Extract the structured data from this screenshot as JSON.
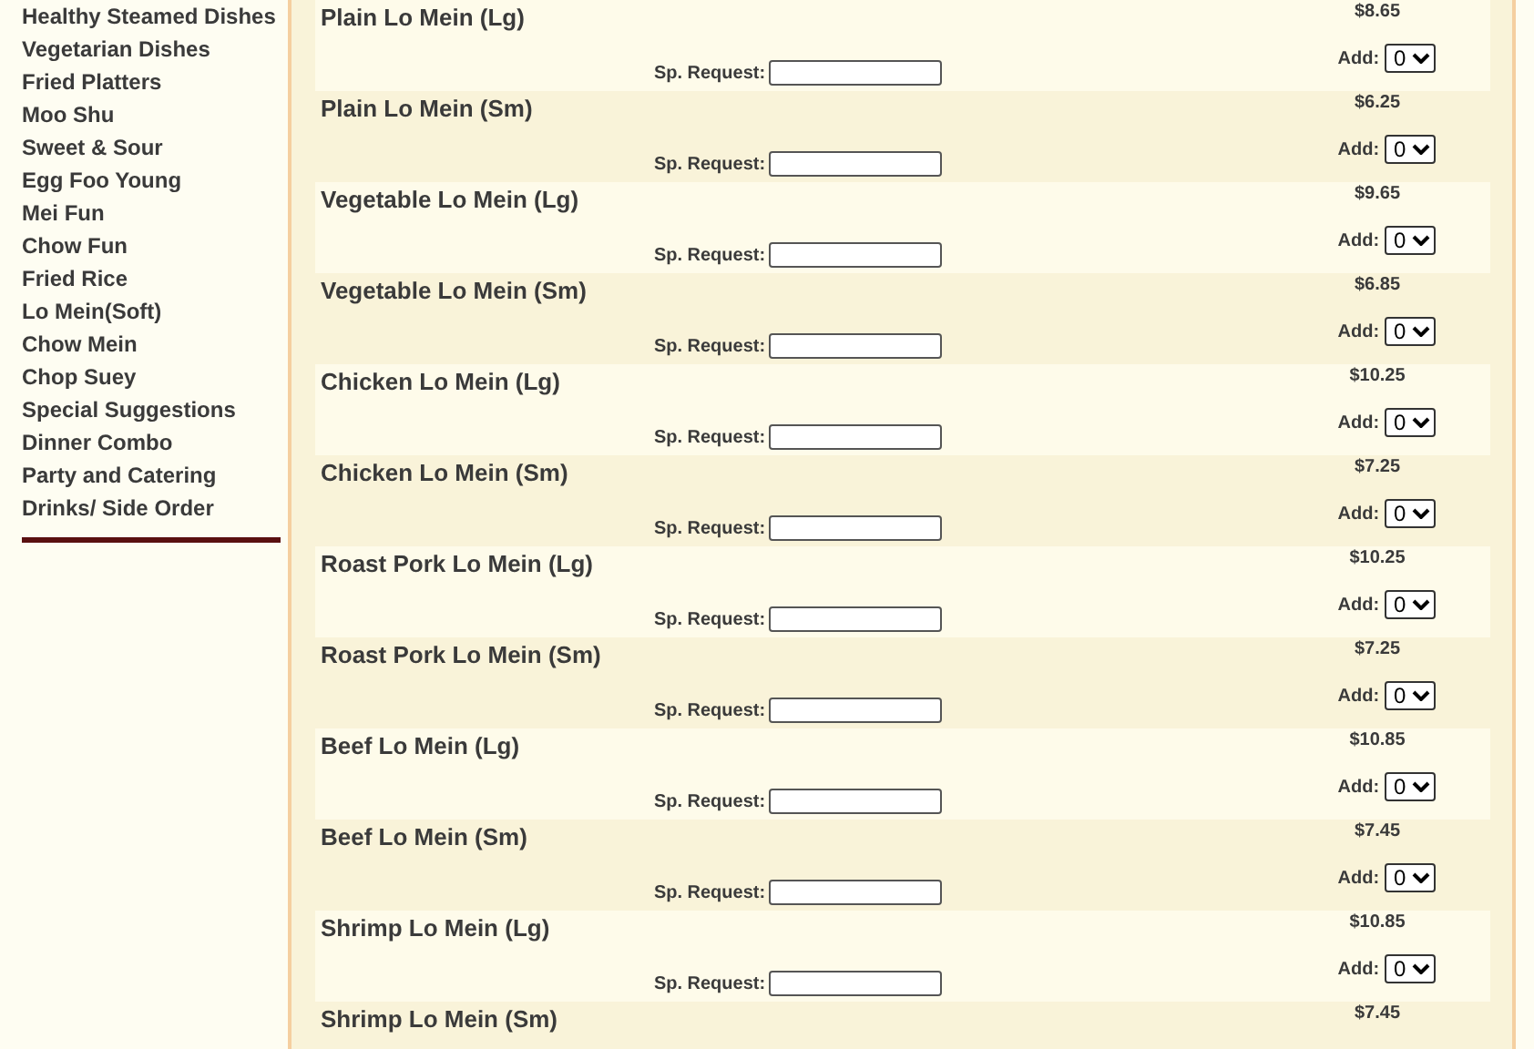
{
  "sidebar": {
    "items": [
      {
        "label": "Healthy Steamed Dishes"
      },
      {
        "label": "Vegetarian Dishes"
      },
      {
        "label": "Fried Platters"
      },
      {
        "label": "Moo Shu"
      },
      {
        "label": "Sweet & Sour"
      },
      {
        "label": "Egg Foo Young"
      },
      {
        "label": "Mei Fun"
      },
      {
        "label": "Chow Fun"
      },
      {
        "label": "Fried Rice"
      },
      {
        "label": "Lo Mein(Soft)"
      },
      {
        "label": "Chow Mein"
      },
      {
        "label": "Chop Suey"
      },
      {
        "label": "Special Suggestions"
      },
      {
        "label": "Dinner Combo"
      },
      {
        "label": "Party and Catering"
      },
      {
        "label": "Drinks/ Side Order"
      }
    ]
  },
  "menu_items": [
    {
      "name": "Plain Lo Mein (Lg)",
      "price": "$8.65",
      "request_label": "Sp. Request:",
      "add_label": "Add:",
      "quantity": "0"
    },
    {
      "name": "Plain Lo Mein (Sm)",
      "price": "$6.25",
      "request_label": "Sp. Request:",
      "add_label": "Add:",
      "quantity": "0"
    },
    {
      "name": "Vegetable Lo Mein (Lg)",
      "price": "$9.65",
      "request_label": "Sp. Request:",
      "add_label": "Add:",
      "quantity": "0"
    },
    {
      "name": "Vegetable Lo Mein (Sm)",
      "price": "$6.85",
      "request_label": "Sp. Request:",
      "add_label": "Add:",
      "quantity": "0"
    },
    {
      "name": "Chicken Lo Mein (Lg)",
      "price": "$10.25",
      "request_label": "Sp. Request:",
      "add_label": "Add:",
      "quantity": "0"
    },
    {
      "name": "Chicken Lo Mein (Sm)",
      "price": "$7.25",
      "request_label": "Sp. Request:",
      "add_label": "Add:",
      "quantity": "0"
    },
    {
      "name": "Roast Pork Lo Mein (Lg)",
      "price": "$10.25",
      "request_label": "Sp. Request:",
      "add_label": "Add:",
      "quantity": "0"
    },
    {
      "name": "Roast Pork Lo Mein (Sm)",
      "price": "$7.25",
      "request_label": "Sp. Request:",
      "add_label": "Add:",
      "quantity": "0"
    },
    {
      "name": "Beef Lo Mein (Lg)",
      "price": "$10.85",
      "request_label": "Sp. Request:",
      "add_label": "Add:",
      "quantity": "0"
    },
    {
      "name": "Beef Lo Mein (Sm)",
      "price": "$7.45",
      "request_label": "Sp. Request:",
      "add_label": "Add:",
      "quantity": "0"
    },
    {
      "name": "Shrimp Lo Mein (Lg)",
      "price": "$10.85",
      "request_label": "Sp. Request:",
      "add_label": "Add:",
      "quantity": "0"
    },
    {
      "name": "Shrimp Lo Mein (Sm)",
      "price": "$7.45"
    }
  ]
}
